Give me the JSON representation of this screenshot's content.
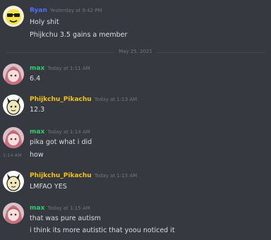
{
  "colors": {
    "background": "#36393f",
    "text": "#dcddde",
    "muted": "#72767d",
    "user_blue": "#4f6ff5",
    "user_green": "#2ecc71",
    "user_yellow": "#f1c40f"
  },
  "date_divider": "May 25, 2021",
  "messages": [
    {
      "username": "Ryan",
      "timestamp": "Yesterday at 9:42 PM",
      "lines": [
        "Holy shit",
        "Phijkchu 3.5 gains a member"
      ]
    },
    {
      "username": "max",
      "timestamp": "Today at 1:11 AM",
      "lines": [
        "6.4"
      ]
    },
    {
      "username": "Phijkchu_Pikachu",
      "timestamp": "Today at 1:13 AM",
      "lines": [
        "12.3"
      ]
    },
    {
      "username": "max",
      "timestamp": "Today at 1:14 AM",
      "lines": [
        "pika got what i did",
        "how"
      ],
      "hover_time": "1:14 AM"
    },
    {
      "username": "Phijkchu_Pikachu",
      "timestamp": "Today at 1:15 AM",
      "lines": [
        "LMFAO YES"
      ]
    },
    {
      "username": "max",
      "timestamp": "Today at 1:15 AM",
      "lines": [
        "that was pure autism",
        "i think its more autistic that yoou noticed it"
      ]
    }
  ]
}
